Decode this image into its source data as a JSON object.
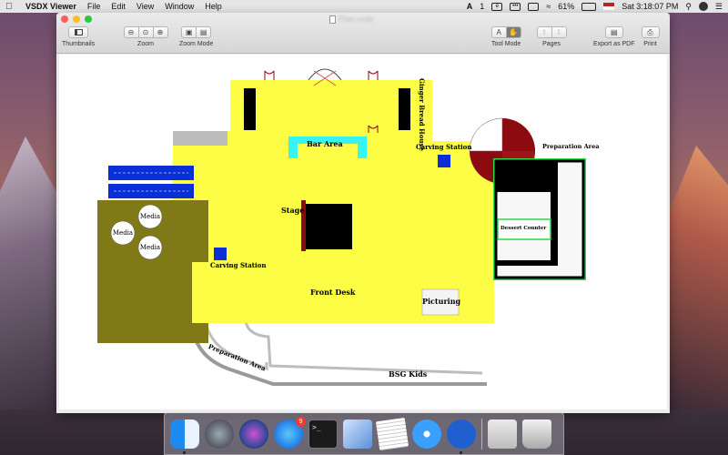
{
  "menubar": {
    "app_name": "VSDX Viewer",
    "menus": [
      "File",
      "Edit",
      "View",
      "Window",
      "Help"
    ],
    "status": {
      "notif_count": "1",
      "battery": "61%",
      "clock": "Sat 3:18:07 PM"
    }
  },
  "window": {
    "document_title": "Plan.vsdx",
    "toolbar": {
      "thumbnails": "Thumbnails",
      "zoom": "Zoom",
      "zoom_mode": "Zoom Mode",
      "tool_mode": "Tool Mode",
      "pages": "Pages",
      "export_pdf": "Export as PDF",
      "print": "Print",
      "tool_mode_text": "A"
    }
  },
  "floorplan": {
    "labels": {
      "ginger_bread_house": "Ginger Bread House",
      "bar_area": "Bar Area",
      "carving_station_top": "Carving Station",
      "preparation_area_top": "Preparation Area",
      "stage": "Stage",
      "dessert_counter": "Dessert Counter",
      "media_1": "Media",
      "media_2": "Media",
      "media_3": "Media",
      "carving_station_left": "Carving Station",
      "front_desk": "Front Desk",
      "picturing": "Picturing",
      "preparation_area_bottom": "Preparation Area",
      "bsg_kids": "BSG Kids"
    },
    "colors": {
      "floor": "#fdfd46",
      "olive": "#7f7a17",
      "bar": "#36f4f4",
      "station": "#0a2fd6",
      "counter_outline": "#2fd64a",
      "maroon": "#8c0a10"
    }
  },
  "dock": {
    "app_store_badge": "9",
    "items": [
      "finder-icon",
      "launchpad-icon",
      "siri-icon",
      "app-store-icon",
      "terminal-icon",
      "preview-icon",
      "textedit-icon",
      "safari-icon",
      "vsdx-viewer-icon",
      "downloads-icon",
      "trash-icon"
    ]
  }
}
